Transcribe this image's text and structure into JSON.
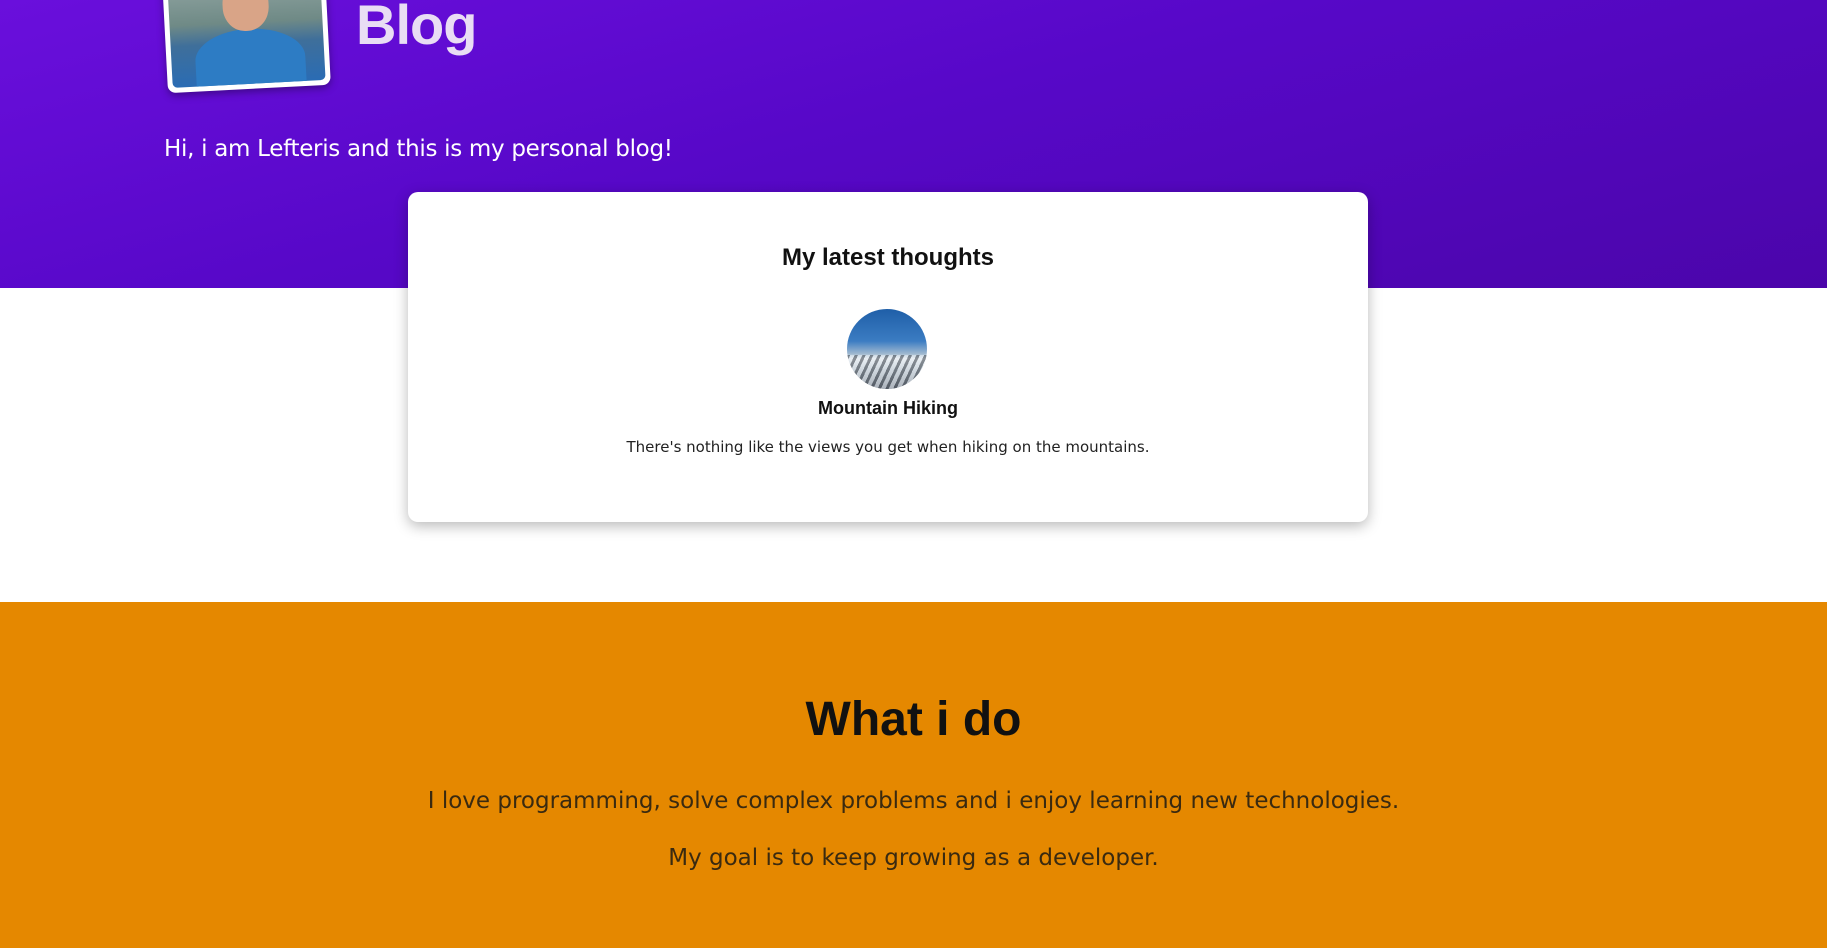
{
  "header": {
    "title": "Blog",
    "intro": "Hi, i am Lefteris and this is my personal blog!",
    "gradient_start": "#6a0fdc",
    "gradient_end": "#4b05aa"
  },
  "latest": {
    "heading": "My latest thoughts",
    "posts": [
      {
        "title": "Mountain Hiking",
        "excerpt": "There's nothing like the views you get when hiking on the mountains.",
        "icon": "mountain-photo"
      }
    ]
  },
  "about": {
    "heading": "What i do",
    "lines": [
      "I love programming, solve complex problems and i enjoy learning new technologies.",
      "My goal is to keep growing as a developer."
    ],
    "background": "#e58800"
  }
}
